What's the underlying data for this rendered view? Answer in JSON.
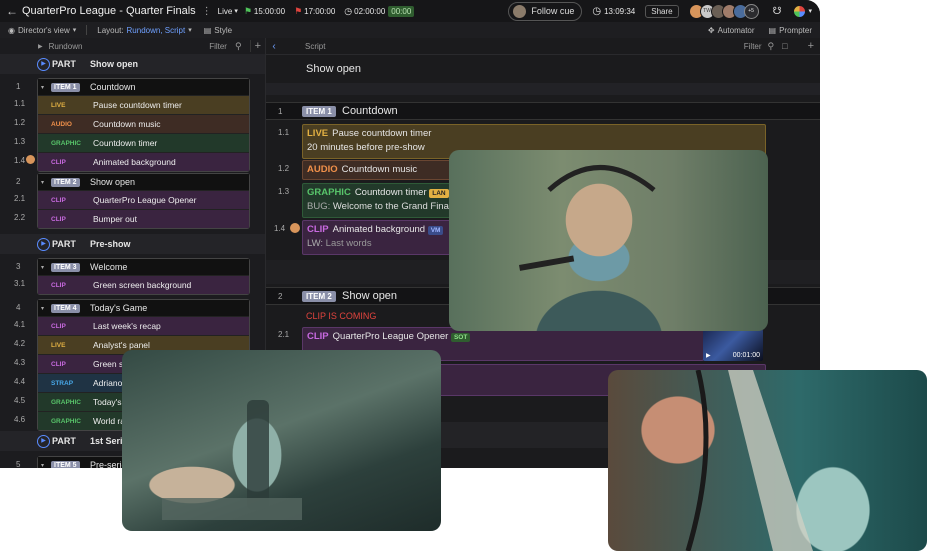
{
  "topbar": {
    "title": "QuarterPro League - Quarter Finals",
    "mode": "Live",
    "start_time": "15:00:00",
    "end_time": "17:00:00",
    "duration": "02:00:00",
    "duration_box": "00:00",
    "follow_cue": "Follow cue",
    "clock": "13:09:34",
    "share": "Share",
    "avatar_initials": [
      "TW",
      "+5"
    ]
  },
  "subbar": {
    "view": "Director's view",
    "layout_label": "Layout:",
    "layout_value": "Rundown, Script",
    "style": "Style",
    "automator": "Automator",
    "prompter": "Prompter"
  },
  "rundown": {
    "header": "Rundown",
    "filter": "Filter",
    "parts": [
      {
        "label": "PART",
        "title": "Show open"
      },
      {
        "label": "PART",
        "title": "Pre-show"
      },
      {
        "label": "PART",
        "title": "1st Series"
      }
    ],
    "items": [
      {
        "num": "1",
        "tag": "ITEM 1",
        "title": "Countdown",
        "subs": [
          {
            "num": "1.1",
            "kind": "LIVE",
            "text": "Pause countdown timer"
          },
          {
            "num": "1.2",
            "kind": "AUDIO",
            "text": "Countdown music"
          },
          {
            "num": "1.3",
            "kind": "GRAPHIC",
            "text": "Countdown timer"
          },
          {
            "num": "1.4",
            "kind": "CLIP",
            "text": "Animated background"
          }
        ]
      },
      {
        "num": "2",
        "tag": "ITEM 2",
        "title": "Show open",
        "subs": [
          {
            "num": "2.1",
            "kind": "CLIP",
            "text": "QuarterPro League Opener"
          },
          {
            "num": "2.2",
            "kind": "CLIP",
            "text": "Bumper out"
          }
        ]
      },
      {
        "num": "3",
        "tag": "ITEM 3",
        "title": "Welcome",
        "subs": [
          {
            "num": "3.1",
            "kind": "CLIP",
            "text": "Green screen background"
          }
        ]
      },
      {
        "num": "4",
        "tag": "ITEM 4",
        "title": "Today's Game",
        "subs": [
          {
            "num": "4.1",
            "kind": "CLIP",
            "text": "Last week's recap"
          },
          {
            "num": "4.2",
            "kind": "LIVE",
            "text": "Analyst's panel"
          },
          {
            "num": "4.3",
            "kind": "CLIP",
            "text": "Green s"
          },
          {
            "num": "4.4",
            "kind": "STRAP",
            "text": "Adriano"
          },
          {
            "num": "4.5",
            "kind": "GRAPHIC",
            "text": "Today's"
          },
          {
            "num": "4.6",
            "kind": "GRAPHIC",
            "text": "World ra"
          }
        ]
      },
      {
        "num": "5",
        "tag": "ITEM 5",
        "title": "Pre-serie",
        "subs": []
      }
    ]
  },
  "script": {
    "header": "Script",
    "filter": "Filter",
    "part_title": "Show open",
    "item1": {
      "num": "1",
      "tag": "ITEM 1",
      "title": "Countdown"
    },
    "cards1": [
      {
        "num": "1.1",
        "kind": "LIVE",
        "text": "Pause countdown timer",
        "line2": "20 minutes before pre-show"
      },
      {
        "num": "1.2",
        "kind": "AUDIO",
        "text": "Countdown music"
      },
      {
        "num": "1.3",
        "kind": "GRAPHIC",
        "text": "Countdown timer",
        "badge": "LAN",
        "line2_key": "BUG:",
        "line2": "Welcome to the Grand Fina"
      },
      {
        "num": "1.4",
        "kind": "CLIP",
        "text": "Animated background",
        "badge": "VM",
        "line2_key": "LW:",
        "line2": "Last words"
      }
    ],
    "item2": {
      "num": "2",
      "tag": "ITEM 2",
      "title": "Show open"
    },
    "clip_coming": "CLIP IS COMING",
    "card2": {
      "num": "2.1",
      "kind": "CLIP",
      "text": "QuarterPro League Opener",
      "badge": "SOT",
      "thumb_time": "00:01:00"
    }
  },
  "colors": {
    "accent": "#5a8cff",
    "live": "#e2b043",
    "audio": "#f0904a",
    "graphic": "#58c46a",
    "clip": "#c86ae0",
    "strap": "#48a8e8"
  }
}
